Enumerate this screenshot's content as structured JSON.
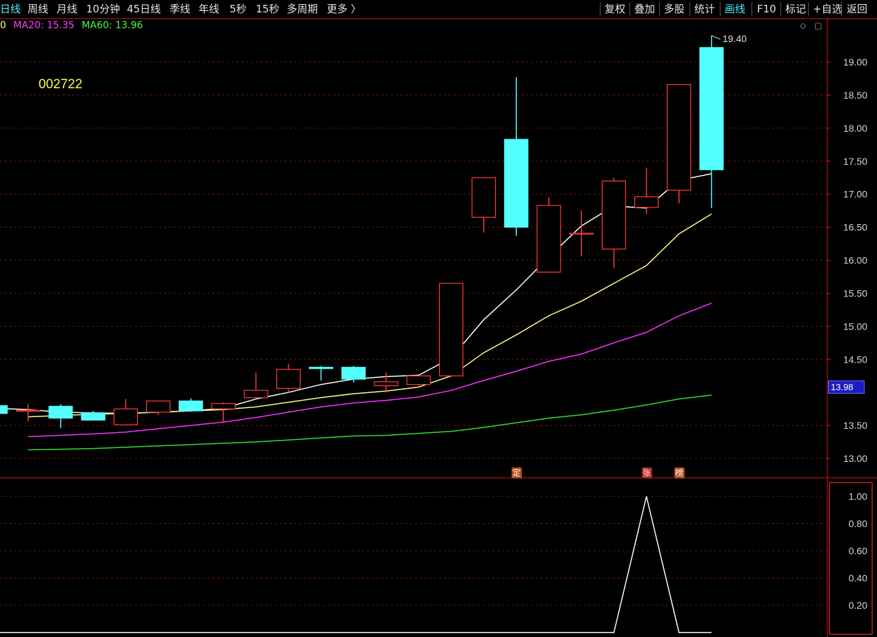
{
  "toolbar": {
    "timeframes": [
      "日线",
      "周线",
      "月线",
      "10分钟",
      "45日线",
      "季线",
      "年线",
      "5秒",
      "15秒",
      "多周期",
      "更多 〉"
    ],
    "active_timeframe": 0,
    "tools": [
      "复权",
      "叠加",
      "多股",
      "统计",
      "画线",
      "F10",
      "标记",
      "+自选",
      "返回"
    ],
    "active_tool": 4
  },
  "ma_legend": {
    "ma5_partial": "0",
    "ma20": "MA20: 15.35",
    "ma60": "MA60: 13.96"
  },
  "stock_code": "002722",
  "max_label": "19.40",
  "current_price": "13.98",
  "markers": [
    {
      "text": "定",
      "bar": 16,
      "color": "#b04a1a"
    },
    {
      "text": "张",
      "bar": 20,
      "color": "#b02020"
    },
    {
      "text": "榜",
      "bar": 21,
      "color": "#b04a1a"
    }
  ],
  "colors": {
    "up": "#ff3c3c",
    "down": "#54ffff",
    "ma5": "#ffffff",
    "ma10": "#ffff88",
    "ma20": "#ff33ff",
    "ma60": "#33dd33",
    "ma20_text": "#ff44ff",
    "ma60_text": "#44ff44",
    "axis": "#c81e1e",
    "grid": "#7a1010",
    "indicator_line": "#ffffff"
  },
  "chart_data": [
    {
      "type": "candlestick",
      "y_ticks": [
        "19.00",
        "18.50",
        "18.00",
        "17.50",
        "17.00",
        "16.50",
        "16.00",
        "15.50",
        "15.00",
        "14.50",
        "13.50",
        "13.00"
      ],
      "ylim": [
        12.8,
        19.65
      ],
      "ohlc": [
        {
          "o": 13.8,
          "h": 13.85,
          "l": 13.68,
          "c": 13.68
        },
        {
          "o": 13.73,
          "h": 13.82,
          "l": 13.56,
          "c": 13.73
        },
        {
          "o": 13.79,
          "h": 13.82,
          "l": 13.46,
          "c": 13.61
        },
        {
          "o": 13.69,
          "h": 13.72,
          "l": 13.58,
          "c": 13.58
        },
        {
          "o": 13.51,
          "h": 13.9,
          "l": 13.51,
          "c": 13.75
        },
        {
          "o": 13.7,
          "h": 13.88,
          "l": 13.66,
          "c": 13.87
        },
        {
          "o": 13.87,
          "h": 13.91,
          "l": 13.72,
          "c": 13.72
        },
        {
          "o": 13.75,
          "h": 13.85,
          "l": 13.55,
          "c": 13.83
        },
        {
          "o": 13.92,
          "h": 14.3,
          "l": 13.9,
          "c": 14.03
        },
        {
          "o": 14.06,
          "h": 14.43,
          "l": 14.0,
          "c": 14.35
        },
        {
          "o": 14.38,
          "h": 14.4,
          "l": 14.18,
          "c": 14.36
        },
        {
          "o": 14.38,
          "h": 14.4,
          "l": 14.15,
          "c": 14.2
        },
        {
          "o": 14.1,
          "h": 14.3,
          "l": 14.0,
          "c": 14.16
        },
        {
          "o": 14.12,
          "h": 14.25,
          "l": 14.1,
          "c": 14.25
        },
        {
          "o": 14.25,
          "h": 15.65,
          "l": 14.23,
          "c": 15.65
        },
        {
          "o": 16.65,
          "h": 17.25,
          "l": 16.42,
          "c": 17.25
        },
        {
          "o": 17.83,
          "h": 18.77,
          "l": 16.37,
          "c": 16.5
        },
        {
          "o": 15.82,
          "h": 16.95,
          "l": 15.82,
          "c": 16.83
        },
        {
          "o": 16.41,
          "h": 16.75,
          "l": 16.06,
          "c": 16.41
        },
        {
          "o": 16.17,
          "h": 17.25,
          "l": 15.88,
          "c": 17.2
        },
        {
          "o": 16.8,
          "h": 17.4,
          "l": 16.7,
          "c": 16.96
        },
        {
          "o": 17.06,
          "h": 18.66,
          "l": 16.86,
          "c": 18.66
        },
        {
          "o": 19.22,
          "h": 19.4,
          "l": 16.79,
          "c": 17.37
        }
      ],
      "ma_series": [
        {
          "name": "MA5",
          "values": [
            13.76,
            13.74,
            13.7,
            13.69,
            13.68,
            13.7,
            13.72,
            13.76,
            13.9,
            14.0,
            14.12,
            14.2,
            14.24,
            14.26,
            14.52,
            15.1,
            15.55,
            16.05,
            16.52,
            16.82,
            16.79,
            17.21,
            17.31
          ]
        },
        {
          "name": "MA10",
          "values": [
            13.63,
            13.65,
            13.67,
            13.68,
            13.7,
            13.72,
            13.74,
            13.78,
            13.85,
            13.92,
            13.98,
            14.02,
            14.08,
            14.25,
            14.6,
            14.87,
            15.16,
            15.38,
            15.65,
            15.92,
            16.4,
            16.7
          ]
        },
        {
          "name": "MA20",
          "values": [
            13.33,
            13.35,
            13.37,
            13.4,
            13.45,
            13.5,
            13.55,
            13.62,
            13.7,
            13.78,
            13.84,
            13.88,
            13.93,
            14.03,
            14.18,
            14.32,
            14.47,
            14.58,
            14.75,
            14.91,
            15.16,
            15.35
          ]
        },
        {
          "name": "MA60",
          "values": [
            13.13,
            13.14,
            13.15,
            13.17,
            13.19,
            13.21,
            13.23,
            13.25,
            13.28,
            13.31,
            13.34,
            13.35,
            13.38,
            13.41,
            13.47,
            13.54,
            13.61,
            13.66,
            13.73,
            13.81,
            13.9,
            13.96
          ]
        }
      ]
    },
    {
      "type": "line",
      "y_ticks": [
        "1.00",
        "0.80",
        "0.60",
        "0.40",
        "0.20"
      ],
      "ylim": [
        0,
        1.1
      ],
      "values": [
        0,
        0,
        0,
        0,
        0,
        0,
        0,
        0,
        0,
        0,
        0,
        0,
        0,
        0,
        0,
        0,
        0,
        0,
        0,
        1,
        0,
        0
      ]
    }
  ]
}
